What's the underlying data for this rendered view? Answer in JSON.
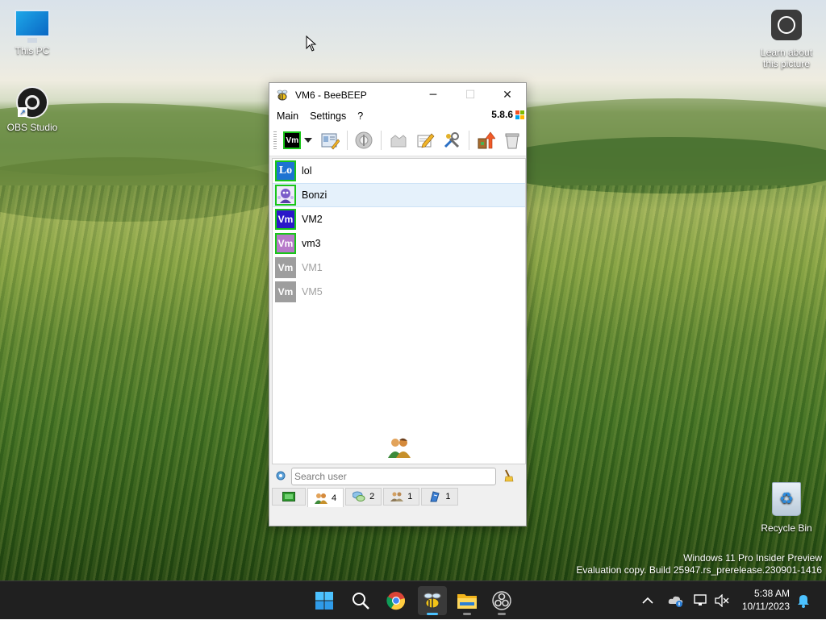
{
  "desktop": {
    "icons": {
      "this_pc": "This PC",
      "obs": "OBS Studio",
      "learn": "Learn about this picture",
      "recycle_bin": "Recycle Bin"
    },
    "watermark": {
      "line1": "Windows 11 Pro Insider Preview",
      "line2": "Evaluation copy. Build 25947.rs_prerelease.230901-1416"
    }
  },
  "window": {
    "title": "VM6 - BeeBEEP",
    "controls": {
      "minimize": "─",
      "maximize": "☐",
      "close": "✕"
    },
    "menu": {
      "main": "Main",
      "settings": "Settings",
      "help": "?"
    },
    "version": "5.8.6",
    "toolbar": {
      "profile_badge": "Vm"
    },
    "users": [
      {
        "initials": "Lo",
        "name": "lol",
        "online": true,
        "color": "#1e73d2",
        "border": "#19c519"
      },
      {
        "initials": "",
        "name": "Bonzi",
        "online": true,
        "color": "#7b5cc9",
        "border": "#19c519",
        "selected": true
      },
      {
        "initials": "Vm",
        "name": "VM2",
        "online": true,
        "color": "#2b18c9",
        "border": "#19c519"
      },
      {
        "initials": "Vm",
        "name": "vm3",
        "online": true,
        "color": "#b77ac9",
        "border": "#19c519"
      },
      {
        "initials": "Vm",
        "name": "VM1",
        "online": false,
        "color": "#9e9e9e",
        "border": "#9e9e9e"
      },
      {
        "initials": "Vm",
        "name": "VM5",
        "online": false,
        "color": "#9e9e9e",
        "border": "#9e9e9e"
      }
    ],
    "search": {
      "placeholder": "Search user"
    },
    "tabs": {
      "users_count": "4",
      "chats_count": "2",
      "groups_count": "1",
      "shares_count": "1"
    }
  },
  "taskbar": {
    "clock": {
      "time": "5:38 AM",
      "date": "10/11/2023"
    }
  },
  "colors": {
    "accent": "#4cc2ff",
    "selection": "#e5f1fb",
    "online_border": "#19c519"
  }
}
